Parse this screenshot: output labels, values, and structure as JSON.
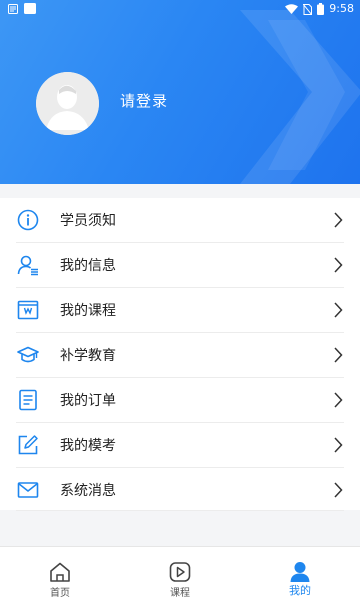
{
  "status_bar": {
    "time": "9:58",
    "icons": [
      "notification-icon",
      "storage-icon",
      "wifi-icon",
      "no-sim-icon",
      "battery-icon"
    ]
  },
  "profile": {
    "login_label": "请登录"
  },
  "menu": {
    "items": [
      {
        "label": "学员须知",
        "icon": "info-icon"
      },
      {
        "label": "我的信息",
        "icon": "user-info-icon"
      },
      {
        "label": "我的课程",
        "icon": "course-icon"
      },
      {
        "label": "补学教育",
        "icon": "education-cap-icon"
      },
      {
        "label": "我的订单",
        "icon": "order-icon"
      },
      {
        "label": "我的模考",
        "icon": "exam-edit-icon"
      },
      {
        "label": "系统消息",
        "icon": "mail-icon"
      }
    ]
  },
  "bottom_nav": {
    "tabs": [
      {
        "label": "首页",
        "icon": "home-icon"
      },
      {
        "label": "课程",
        "icon": "play-icon"
      },
      {
        "label": "我的",
        "icon": "person-icon",
        "active": true
      }
    ]
  },
  "colors": {
    "accent": "#1e86ee",
    "header_start": "#3d97f5",
    "header_end": "#1e73ee"
  }
}
